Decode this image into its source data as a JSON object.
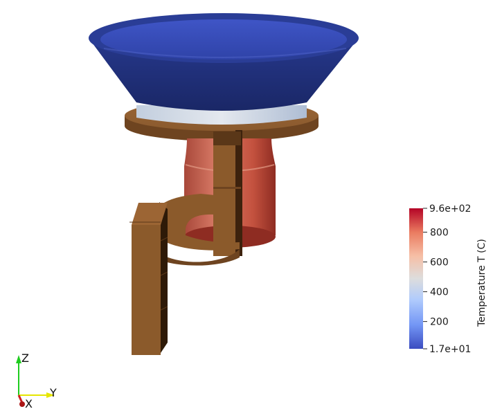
{
  "colorbar": {
    "title": "Temperature T (C)",
    "max_label": "9.6e+02",
    "min_label": "1.7e+01",
    "min_value": 17,
    "max_value": 960,
    "ticks": [
      {
        "value": 800,
        "label": "800"
      },
      {
        "value": 600,
        "label": "600"
      },
      {
        "value": 400,
        "label": "400"
      },
      {
        "value": 200,
        "label": "200"
      }
    ],
    "colormap": [
      "#3b4cc0",
      "#7396f5",
      "#b0cbfc",
      "#dddddd",
      "#f6bfa6",
      "#ea7b60",
      "#b40426"
    ]
  },
  "orientation_axes": {
    "z_label": "Z",
    "y_label": "Y",
    "x_label": "X",
    "z_color": "#1fcc1f",
    "y_color": "#e6e600",
    "x_color": "#cc1f1f"
  },
  "scene": {
    "crucible_color": "#2a3d96",
    "holder_color": "#8b5a2b",
    "heater_color": "#c4523f"
  }
}
